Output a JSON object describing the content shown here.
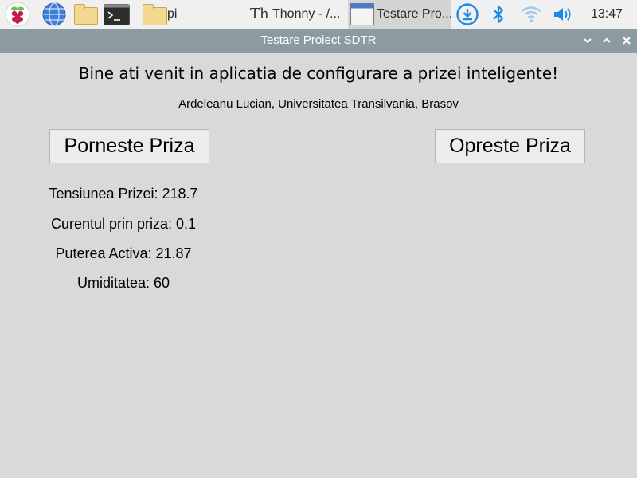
{
  "taskbar": {
    "pi_folder_label": "pi",
    "thonny_task": "Thonny  -  /...",
    "testare_task": "Testare Pro...",
    "clock": "13:47"
  },
  "window": {
    "title": "Testare Proiect SDTR"
  },
  "app": {
    "welcome": "Bine ati venit in aplicatia de configurare a prizei inteligente!",
    "author": "Ardeleanu Lucian, Universitatea Transilvania, Brasov",
    "start_button": "Porneste Priza",
    "stop_button": "Opreste Priza",
    "readings": [
      {
        "text": "Tensiunea Prizei: 218.7"
      },
      {
        "text": "Curentul prin priza: 0.1"
      },
      {
        "text": "Puterea Activa: 21.87"
      },
      {
        "text": "Umiditatea: 60"
      }
    ]
  },
  "colors": {
    "taskbar_bg": "#f0f0f0",
    "titlebar_bg": "#8c9ba1",
    "window_bg": "#d9d9d9",
    "accent_blue": "#1e88e5"
  }
}
